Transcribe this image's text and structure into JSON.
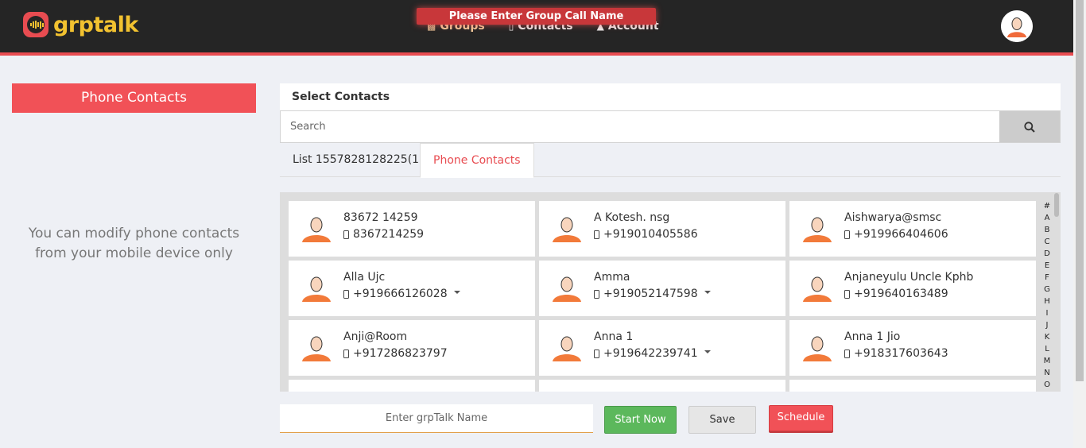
{
  "app": {
    "logo_text": "grptalk",
    "brand_color": "#f2c230",
    "accent_color": "#e84c51"
  },
  "toast": {
    "message": "Please Enter Group Call Name"
  },
  "nav": {
    "items": [
      {
        "label": "Groups",
        "icon": "users-icon",
        "active": true
      },
      {
        "label": "Contacts",
        "icon": "address-book-icon",
        "active": false
      },
      {
        "label": "Account",
        "icon": "account-icon",
        "active": false
      }
    ]
  },
  "left_panel": {
    "title": "Phone Contacts",
    "message_line1": "You can modify phone contacts",
    "message_line2": "from your mobile device only"
  },
  "main": {
    "header": "Select Contacts",
    "search_placeholder": "Search",
    "tabs": [
      {
        "label": "List 1557828128225(1)",
        "active": false
      },
      {
        "label": "Phone Contacts",
        "active": true
      }
    ]
  },
  "contacts": [
    {
      "name": "83672 14259",
      "phone": "8367214259",
      "has_more": false
    },
    {
      "name": "A Kotesh. nsg",
      "phone": "+919010405586",
      "has_more": false
    },
    {
      "name": "Aishwarya@smsc",
      "phone": "+919966404606",
      "has_more": false
    },
    {
      "name": "Alla Ujc",
      "phone": "+919666126028",
      "has_more": true
    },
    {
      "name": "Amma",
      "phone": "+919052147598",
      "has_more": true
    },
    {
      "name": "Anjaneyulu Uncle Kphb",
      "phone": "+919640163489",
      "has_more": false
    },
    {
      "name": "Anji@Room",
      "phone": "+917286823797",
      "has_more": false
    },
    {
      "name": "Anna 1",
      "phone": "+919642239741",
      "has_more": true
    },
    {
      "name": "Anna 1 Jio",
      "phone": "+918317603643",
      "has_more": false
    }
  ],
  "alphabet": [
    "#",
    "A",
    "B",
    "C",
    "D",
    "E",
    "F",
    "G",
    "H",
    "I",
    "J",
    "K",
    "L",
    "M",
    "N",
    "O"
  ],
  "footer": {
    "name_placeholder": "Enter grpTalk Name",
    "start_label": "Start Now",
    "save_label": "Save",
    "schedule_label": "Schedule"
  }
}
